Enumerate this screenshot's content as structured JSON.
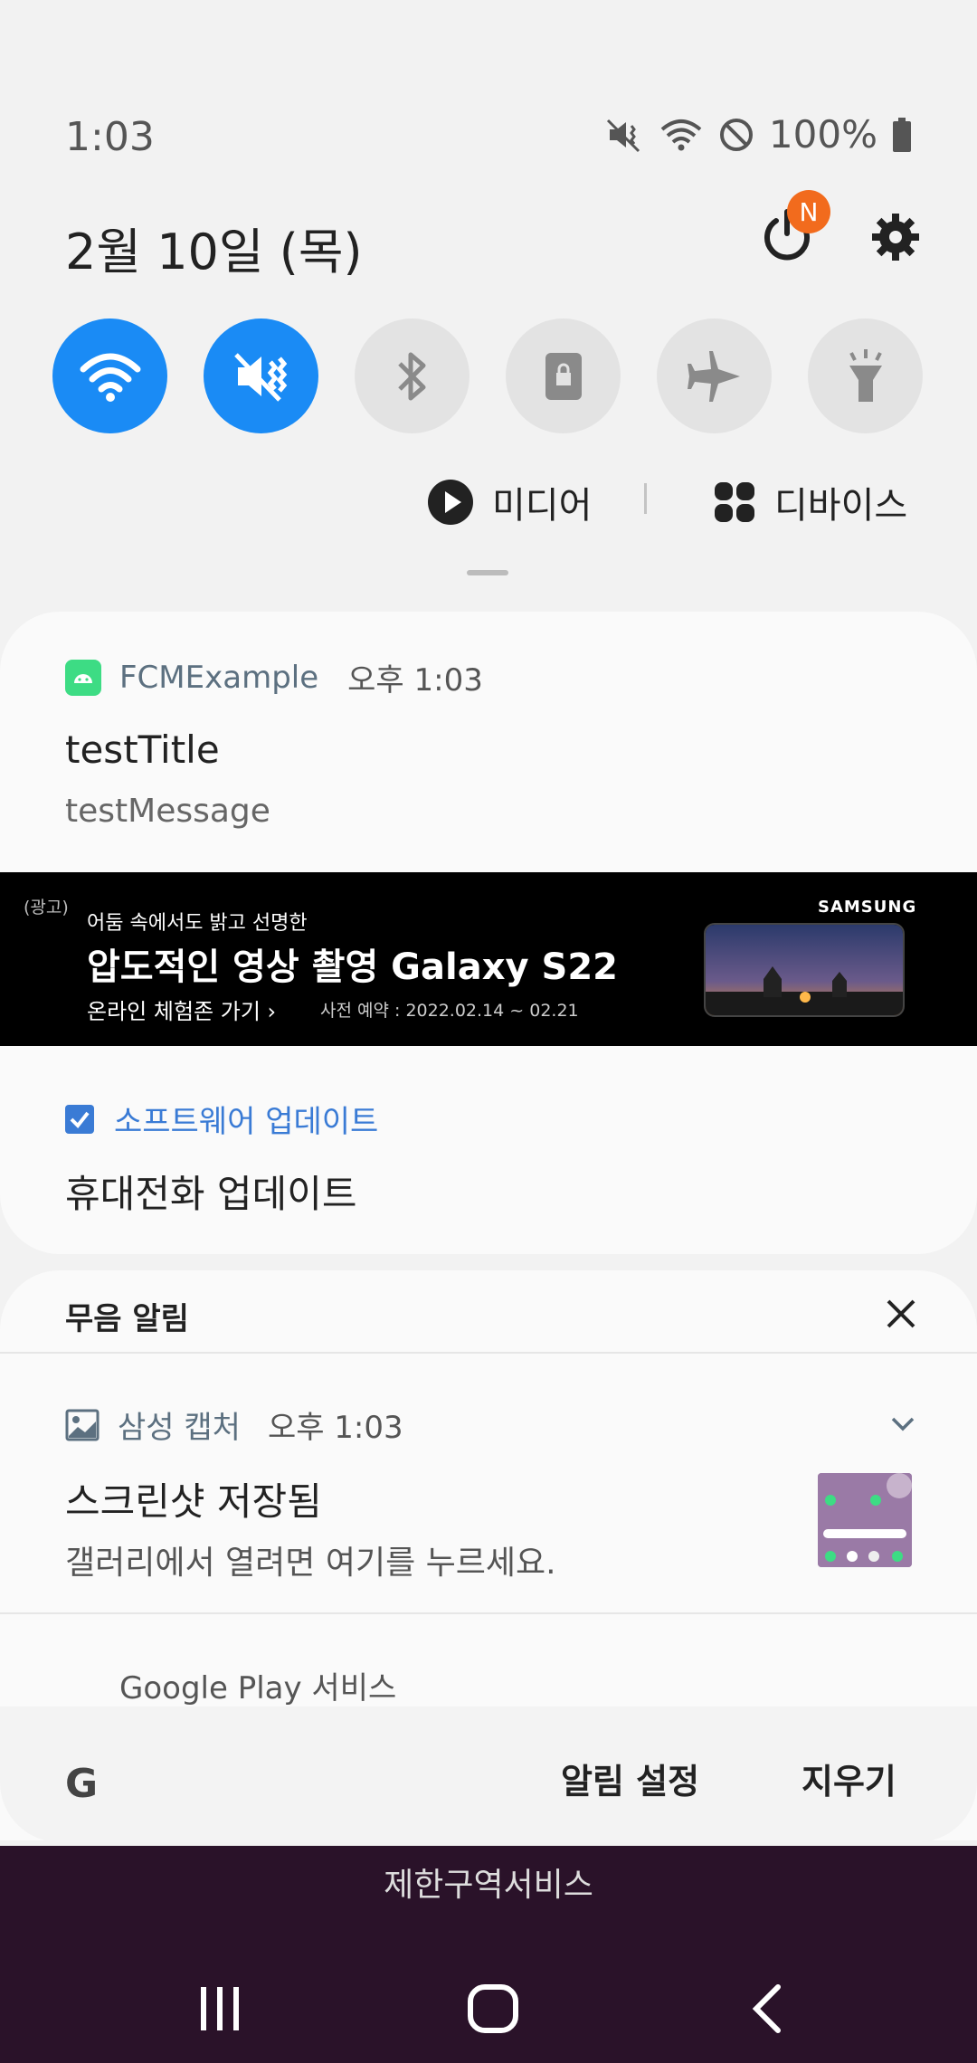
{
  "status": {
    "time": "1:03",
    "battery": "100%"
  },
  "date": "2월 10일 (목)",
  "power_badge": "N",
  "tiles": [
    {
      "name": "wifi",
      "on": true
    },
    {
      "name": "mute-vibrate",
      "on": true
    },
    {
      "name": "bluetooth",
      "on": false
    },
    {
      "name": "screen-lock",
      "on": false
    },
    {
      "name": "airplane",
      "on": false
    },
    {
      "name": "flashlight",
      "on": false
    }
  ],
  "media_label": "미디어",
  "devices_label": "디바이스",
  "notification": {
    "app": "FCMExample",
    "time": "오후 1:03",
    "title": "testTitle",
    "message": "testMessage"
  },
  "ad": {
    "tag": "(광고)",
    "line1": "어둠 속에서도 밝고 선명한",
    "line2": "압도적인 영상 촬영 Galaxy S22",
    "line3": "온라인 체험존 가기 ›",
    "line4": "사전 예약 : 2022.02.14 ~ 02.21",
    "brand": "SAMSUNG"
  },
  "software_update": {
    "app": "소프트웨어 업데이트",
    "text": "휴대전화 업데이트"
  },
  "silent": {
    "header": "무음 알림",
    "capture": {
      "app": "삼성 캡처",
      "time": "오후 1:03",
      "title": "스크린샷 저장됨",
      "message": "갤러리에서 열려면 여기를 누르세요."
    },
    "next_app": "Google Play 서비스"
  },
  "footer": {
    "logo": "G",
    "settings": "알림 설정",
    "clear": "지우기"
  },
  "home_label": "제한구역서비스",
  "colors": {
    "accent": "#1a8bf5",
    "badge": "#f26b1d"
  }
}
